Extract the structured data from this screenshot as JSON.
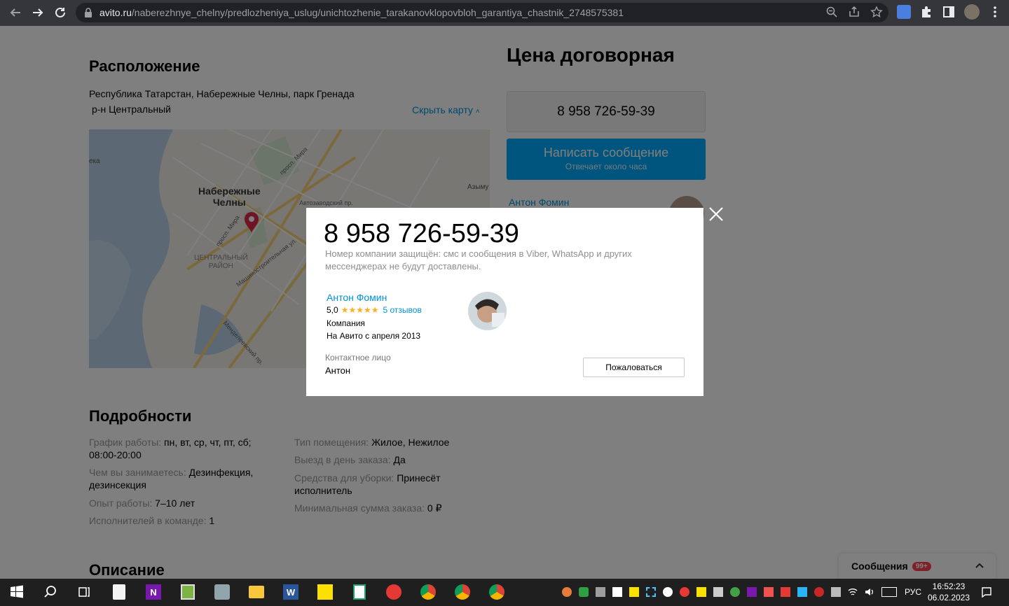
{
  "browser": {
    "url_domain": "avito.ru",
    "url_path": "/naberezhnye_chelny/predlozheniya_uslug/unichtozhenie_tarakanovklopovbloh_garantiya_chastnik_2748575381"
  },
  "location": {
    "title": "Расположение",
    "address_line1": "Республика Татарстан, Набережные Челны, парк Гренада",
    "address_line2": "р-н Центральный",
    "hide_map": "Скрыть карту",
    "map_labels": {
      "city_line1": "Набережные",
      "city_line2": "Челны",
      "district_line1": "ЦЕНТРАЛЬНЫЙ",
      "district_line2": "РАЙОН",
      "left_edge": "ека",
      "right_edge": "Азыму",
      "street1": "просп. Мира",
      "street2": "Машиностроительная ул.",
      "street3": "Автозаводский пр.",
      "street4": "просп. Мира",
      "street5": "Менделеевский пр."
    }
  },
  "sidebar": {
    "price": "Цена договорная",
    "phone": "8 958 726-59-39",
    "message_button": "Написать сообщение",
    "message_sub": "Отвечает около часа",
    "seller_name": "Антон Фомин"
  },
  "details": {
    "title": "Подробности",
    "left": [
      {
        "key": "График работы:",
        "value": "пн, вт, ср, чт, пт, сб;",
        "value2": "08:00-20:00"
      },
      {
        "key": "Чем вы занимаетесь:",
        "value": "Дезинфекция,",
        "value2": "дезинсекция"
      },
      {
        "key": "Опыт работы:",
        "value": "7–10 лет",
        "value2": ""
      },
      {
        "key": "Исполнителей в команде:",
        "value": "1",
        "value2": ""
      }
    ],
    "right": [
      {
        "key": "Тип помещения:",
        "value": "Жилое, Нежилое",
        "value2": ""
      },
      {
        "key": "Выезд в день заказа:",
        "value": "Да",
        "value2": ""
      },
      {
        "key": "Средства для уборки:",
        "value": "Принесёт",
        "value2": "исполнитель"
      },
      {
        "key": "Минимальная сумма заказа:",
        "value": "0 ₽",
        "value2": ""
      }
    ]
  },
  "description_title": "Описание",
  "messages": {
    "label": "Сообщения",
    "badge": "99+"
  },
  "modal": {
    "phone": "8 958 726-59-39",
    "warning": "Номер компании защищён: смс и сообщения в Viber, WhatsApp и других мессенджерах не будут доставлены.",
    "seller_name": "Антон Фомин",
    "rating": "5,0",
    "stars": "★★★★★",
    "reviews": "5 отзывов",
    "seller_type": "Компания",
    "since": "На Авито с апреля 2013",
    "contact_label": "Контактное лицо",
    "contact_name": "Антон",
    "complain_button": "Пожаловаться"
  },
  "taskbar": {
    "language": "РУС",
    "time": "16:52:23",
    "date": "06.02.2023"
  }
}
